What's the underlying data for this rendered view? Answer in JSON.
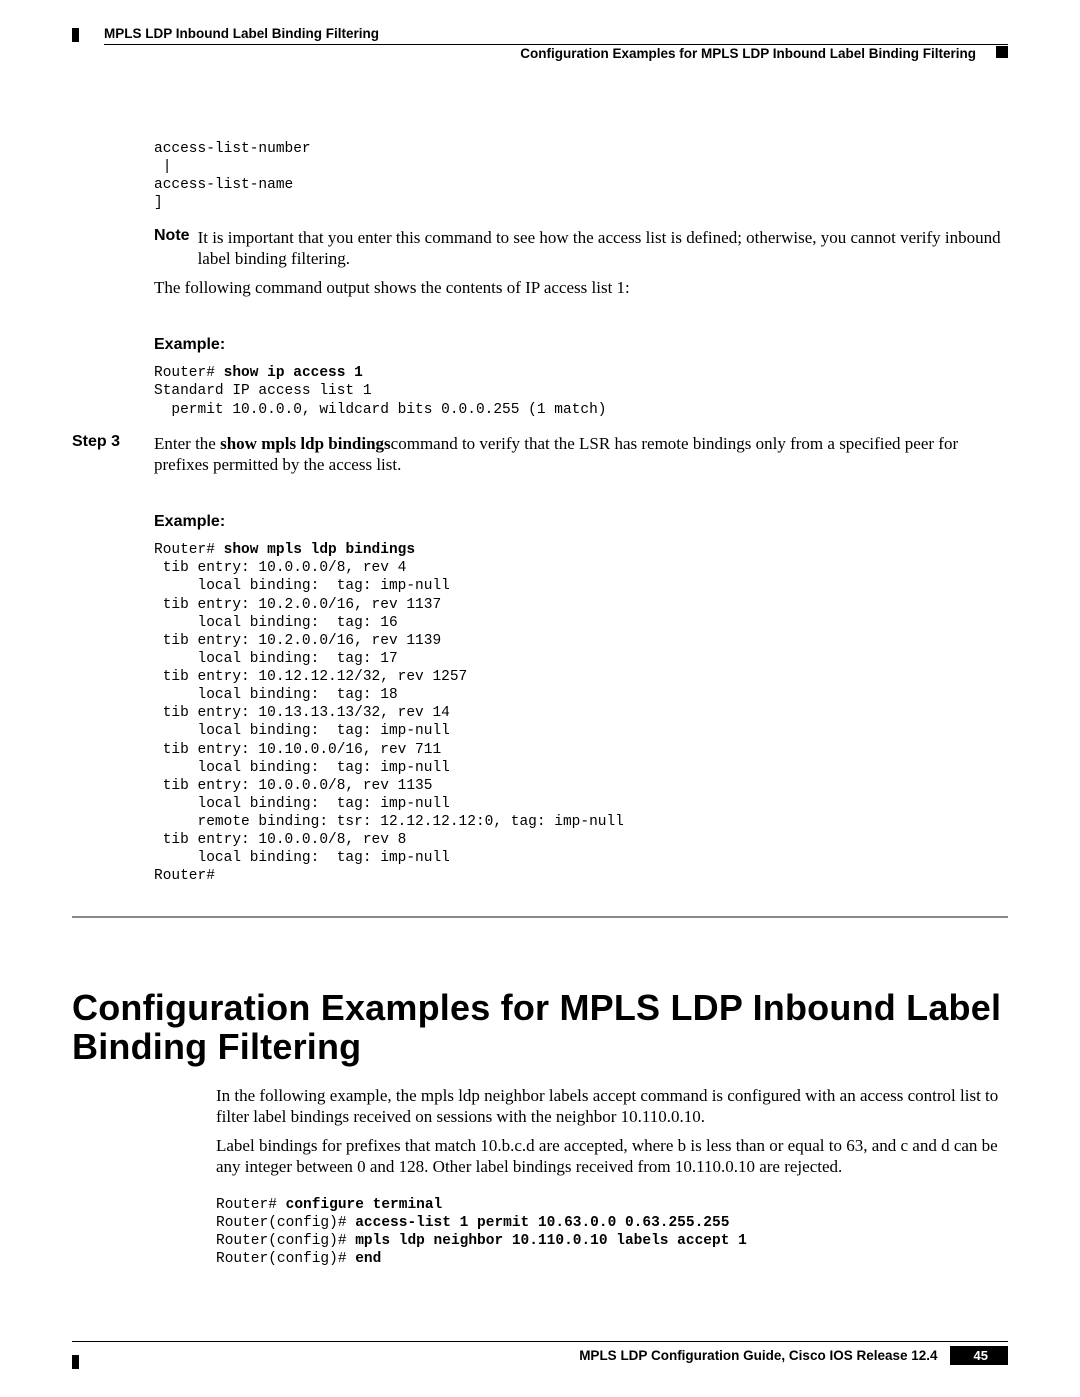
{
  "header": {
    "left_title": "MPLS LDP Inbound Label Binding Filtering",
    "right_subtitle": "Configuration Examples for MPLS LDP Inbound Label Binding Filtering"
  },
  "block1": {
    "pre": "access-list-number\n |\naccess-list-name\n]"
  },
  "note": {
    "label": "Note",
    "text": "It is important that you enter this command to see how the access list is defined; otherwise, you cannot verify inbound label binding filtering."
  },
  "para1": "The following command output shows the contents of IP access list 1:",
  "example1": {
    "label": "Example:",
    "prompt": "Router# ",
    "cmd": "show ip access 1",
    "output": "Standard IP access list 1\n  permit 10.0.0.0, wildcard bits 0.0.0.255 (1 match)"
  },
  "step3": {
    "label": "Step 3",
    "pre": "Enter the ",
    "cmd": "show mpls ldp bindings",
    "post": "command to verify that the LSR has remote bindings only from a specified peer for prefixes permitted by the access list."
  },
  "example2": {
    "label": "Example:",
    "prompt": "Router# ",
    "cmd": "show mpls ldp bindings",
    "output": " tib entry: 10.0.0.0/8, rev 4\n     local binding:  tag: imp-null\n tib entry: 10.2.0.0/16, rev 1137\n     local binding:  tag: 16\n tib entry: 10.2.0.0/16, rev 1139\n     local binding:  tag: 17\n tib entry: 10.12.12.12/32, rev 1257\n     local binding:  tag: 18\n tib entry: 10.13.13.13/32, rev 14\n     local binding:  tag: imp-null\n tib entry: 10.10.0.0/16, rev 711\n     local binding:  tag: imp-null\n tib entry: 10.0.0.0/8, rev 1135\n     local binding:  tag: imp-null\n     remote binding: tsr: 12.12.12.12:0, tag: imp-null\n tib entry: 10.0.0.0/8, rev 8\n     local binding:  tag: imp-null\nRouter#"
  },
  "section2": {
    "heading": "Configuration Examples for MPLS LDP Inbound Label Binding Filtering",
    "para1": "In the following example, the mpls ldp neighbor labels accept command is configured with an access control list to filter label bindings received on sessions with the neighbor 10.110.0.10.",
    "para2": "Label bindings for prefixes that match 10.b.c.d are accepted, where b is less than or equal to 63, and c and d can be any integer between 0 and 128. Other label bindings received from 10.110.0.10 are rejected.",
    "code": {
      "p1": "Router# ",
      "c1": "configure terminal",
      "p2": "Router(config)# ",
      "c2": "access-list 1 permit 10.63.0.0 0.63.255.255",
      "p3": "Router(config)# ",
      "c3": "mpls ldp neighbor 10.110.0.10 labels accept 1",
      "p4": "Router(config)# ",
      "c4": "end"
    }
  },
  "footer": {
    "title": "MPLS LDP Configuration Guide, Cisco IOS Release 12.4",
    "page": "45"
  }
}
